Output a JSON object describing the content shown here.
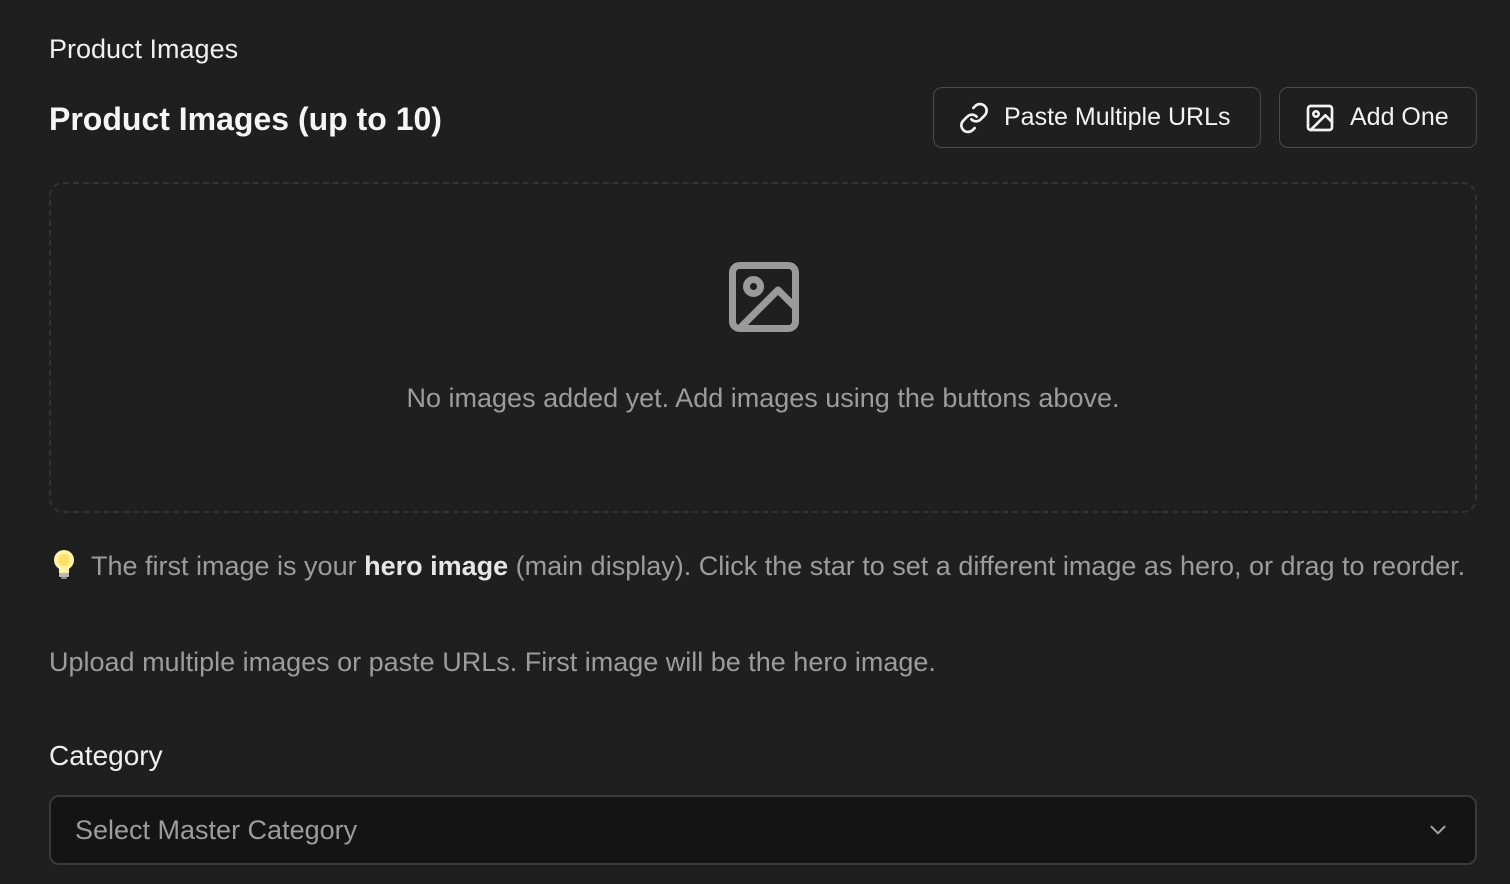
{
  "images_section": {
    "label": "Product Images",
    "title": "Product Images (up to 10)",
    "paste_button_label": "Paste Multiple URLs",
    "add_button_label": "Add One",
    "empty_state_text": "No images added yet. Add images using the buttons above.",
    "hint_prefix": "The first image is your",
    "hint_bold": "hero image",
    "hint_suffix": "(main display). Click the star to set a different image as hero, or drag to reorder.",
    "helper_text": "Upload multiple images or paste URLs. First image will be the hero image."
  },
  "category": {
    "label": "Category",
    "selected": "Select Master Category"
  },
  "icons": {
    "paste": "link-icon",
    "add": "image-icon",
    "empty": "image-placeholder-icon",
    "hint": "lightbulb-icon",
    "select": "chevron-down-icon"
  },
  "colors": {
    "background": "#1f1f1f",
    "muted_text": "#9c9c9c",
    "border": "#4a4a4a",
    "select_background": "#141414"
  }
}
